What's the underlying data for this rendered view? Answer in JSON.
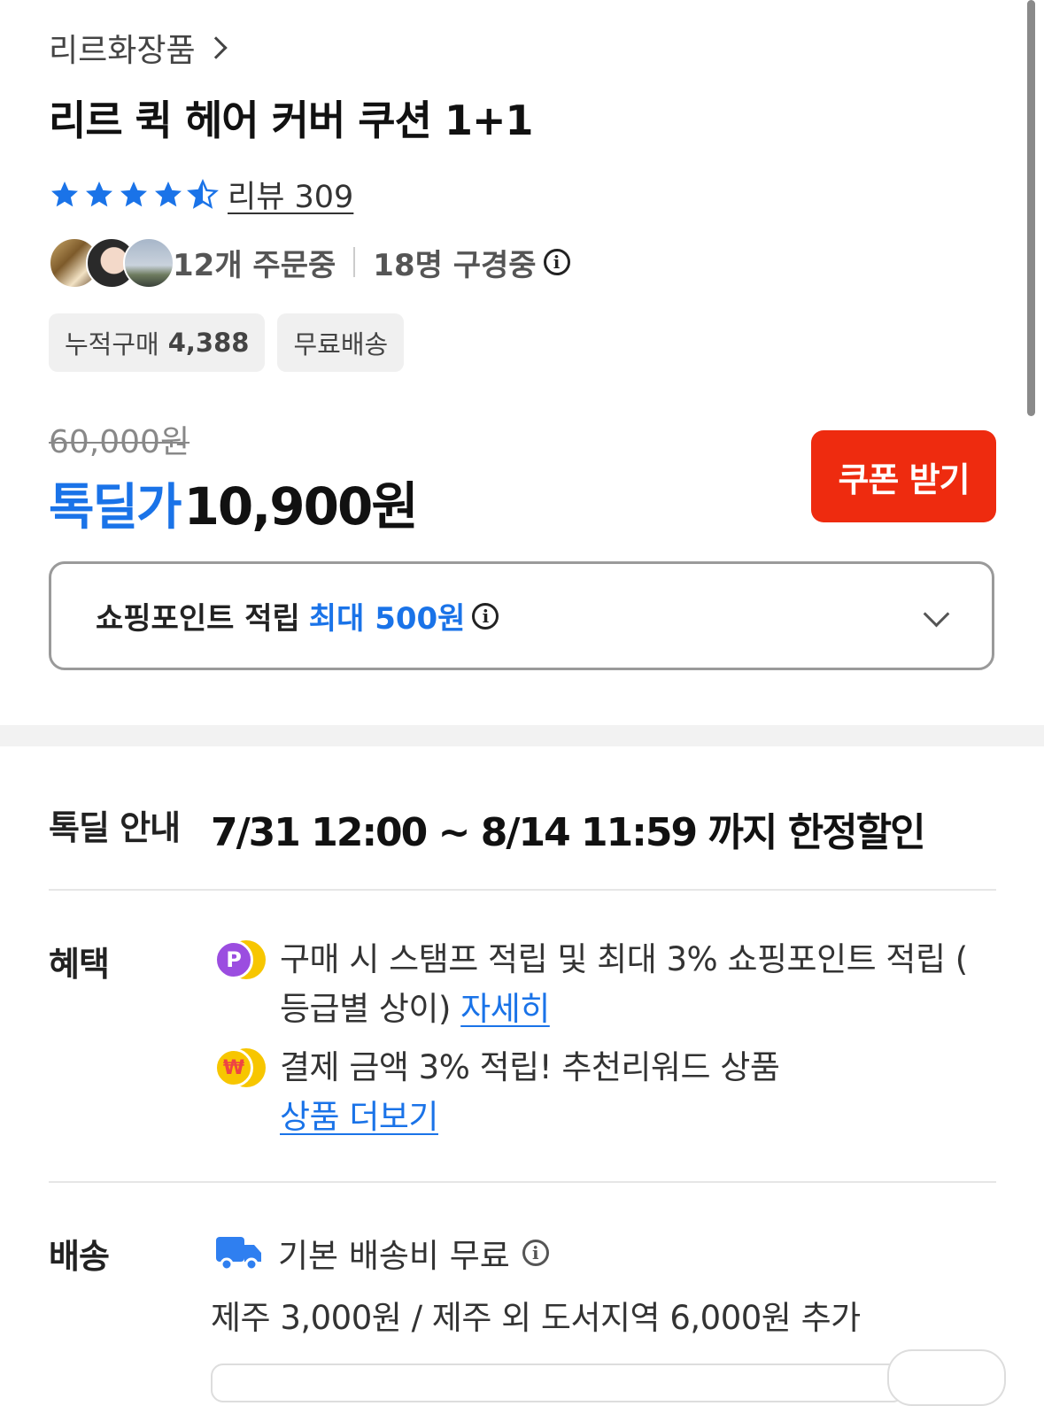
{
  "product": {
    "brand": "리르화장품",
    "title": "리르 퀵 헤어 커버 쿠션 1+1",
    "rating": 4.5,
    "review_label": "리뷰 309"
  },
  "activity": {
    "ordering": "12개 주문중",
    "viewing": "18명 구경중"
  },
  "chips": {
    "cumulative_label": "누적구매",
    "cumulative_value": "4,388",
    "free_shipping": "무료배송"
  },
  "price": {
    "original": "60,000원",
    "deal_label": "톡딜가",
    "deal_price": "10,900원",
    "coupon_button": "쿠폰 받기"
  },
  "points": {
    "label": "쇼핑포인트 적립",
    "highlight": "최대 500원"
  },
  "deal_info": {
    "label": "톡딜 안내",
    "period": "7/31 12:00 ~ 8/14 11:59",
    "suffix": "까지 한정할인"
  },
  "benefits": {
    "label": "혜택",
    "items": [
      {
        "icon": "P",
        "text": "구매 시 스탬프 적립 및 최대 3% 쇼핑포인트 적립 ( 등급별 상이) ",
        "link": "자세히"
      },
      {
        "icon": "₩",
        "text": "결제 금액 3% 적립! 추천리워드 상품 ",
        "link": "상품 더보기"
      }
    ]
  },
  "shipping": {
    "label": "배송",
    "basic": "기본 배송비 무료",
    "extra": "제주 3,000원 / 제주 외 도서지역 6,000원 추가"
  },
  "colors": {
    "accent_blue": "#1a73e8",
    "coupon_red": "#ee2b0f",
    "point_purple": "#9b4de0",
    "coin_yellow": "#f7c600"
  }
}
